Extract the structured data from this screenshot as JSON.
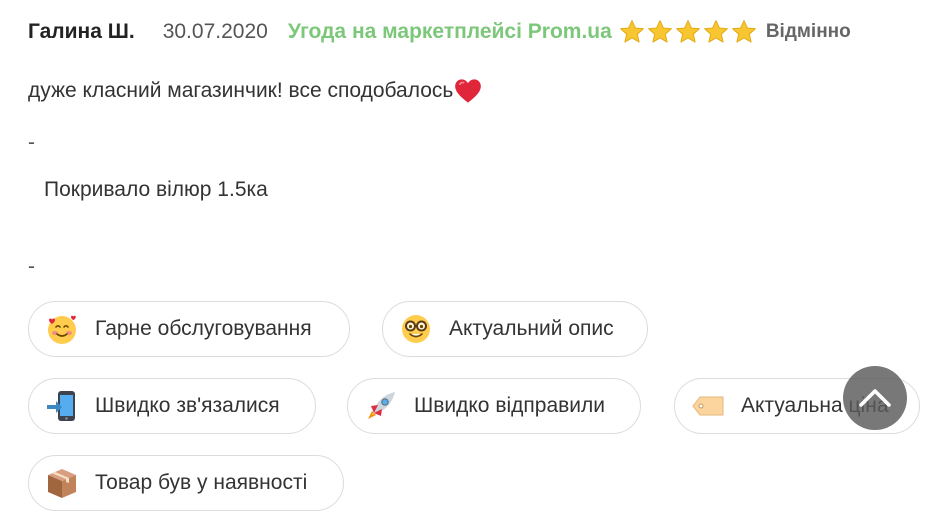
{
  "review": {
    "author": "Галина Ш.",
    "date": "30.07.2020",
    "deal_label": "Угода на маркетплейсі Prom.ua",
    "rating": 5,
    "rating_label": "Відмінно",
    "text": "дуже класний магазинчик! все сподобалось",
    "text_emoji": "heart-icon",
    "separator": "-",
    "product": "Покривало вілюр 1.5ка"
  },
  "tags": [
    {
      "label": "Гарне обслуговування",
      "icon": "smiling-face-with-hearts-icon"
    },
    {
      "label": "Актуальний опис",
      "icon": "nerd-face-icon"
    },
    {
      "label": "Швидко зв'язалися",
      "icon": "mobile-phone-arrow-icon"
    },
    {
      "label": "Швидко відправили",
      "icon": "rocket-icon"
    },
    {
      "label": "Актуальна ціна",
      "icon": "price-tag-icon"
    },
    {
      "label": "Товар був у наявності",
      "icon": "package-icon"
    }
  ],
  "scroll_top": {
    "icon": "chevron-up-icon"
  },
  "colors": {
    "deal": "#7cc77a",
    "star": "#f7c631",
    "heart": "#e0263b",
    "chip_border": "#dcdcdc",
    "scroll_button": "#5a5a5a"
  }
}
